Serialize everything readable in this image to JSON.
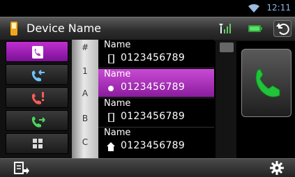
{
  "status": {
    "time": "12:11"
  },
  "header": {
    "title": "Device Name"
  },
  "index": [
    "#",
    "1",
    "A",
    "B",
    "C"
  ],
  "contacts": [
    {
      "name": "Name",
      "number": "0123456789",
      "icon": "mobile-phone-icon"
    },
    {
      "name": "Name",
      "number": "0123456789",
      "icon": "dot-icon"
    },
    {
      "name": "Name",
      "number": "0123456789",
      "icon": "mobile-phone-icon"
    },
    {
      "name": "Name",
      "number": "0123456789",
      "icon": "home-icon"
    }
  ],
  "sidebar": {
    "items": [
      {
        "icon": "phonebook-icon"
      },
      {
        "icon": "outgoing-call-icon"
      },
      {
        "icon": "missed-call-icon"
      },
      {
        "icon": "incoming-call-icon"
      },
      {
        "icon": "dialpad-icon"
      }
    ]
  },
  "colors": {
    "accent": "#b43cc8",
    "call_green": "#22c23a"
  }
}
